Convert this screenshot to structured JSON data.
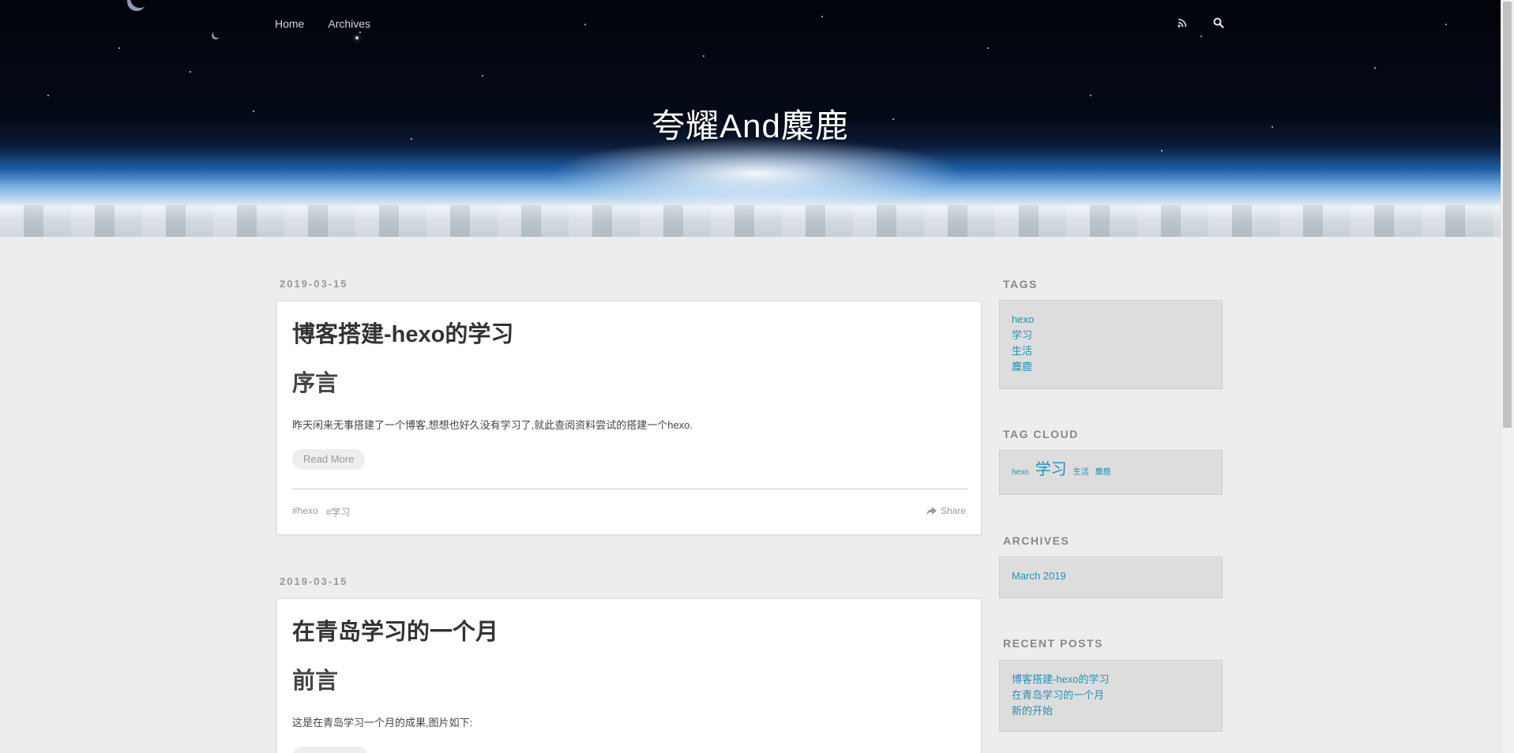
{
  "nav": {
    "home": "Home",
    "archives": "Archives",
    "rss_icon": "rss-icon",
    "search_icon": "search-icon"
  },
  "site": {
    "title": "夸耀And麋鹿"
  },
  "articles": [
    {
      "date": "2019-03-15",
      "title": "博客搭建-hexo的学习",
      "heading": "序言",
      "excerpt": " 昨天闲来无事搭建了一个博客,想想也好久没有学习了,就此查阅资料尝试的搭建一个hexo.",
      "read_more": "Read More",
      "tags": [
        "#hexo",
        "#学习"
      ],
      "share": "Share"
    },
    {
      "date": "2019-03-15",
      "title": "在青岛学习的一个月",
      "heading": "前言",
      "excerpt": "这是在青岛学习一个月的成果,图片如下:"
    }
  ],
  "sidebar": {
    "tags_title": "TAGS",
    "tags": [
      "hexo",
      "学习",
      "生活",
      "麋鹿"
    ],
    "tag_cloud_title": "TAG CLOUD",
    "tag_cloud": [
      {
        "label": "hexo",
        "weight": 1
      },
      {
        "label": "学习",
        "weight": 2
      },
      {
        "label": "生活",
        "weight": 1
      },
      {
        "label": "麋鹿",
        "weight": 1
      }
    ],
    "archives_title": "ARCHIVES",
    "archives": [
      "March 2019"
    ],
    "recent_title": "RECENT POSTS",
    "recent": [
      "博客搭建-hexo的学习",
      "在青岛学习的一个月",
      "新的开始"
    ]
  },
  "colors": {
    "link": "#258fb8",
    "page_bg": "#ededed",
    "widget_bg": "#dddddd"
  }
}
